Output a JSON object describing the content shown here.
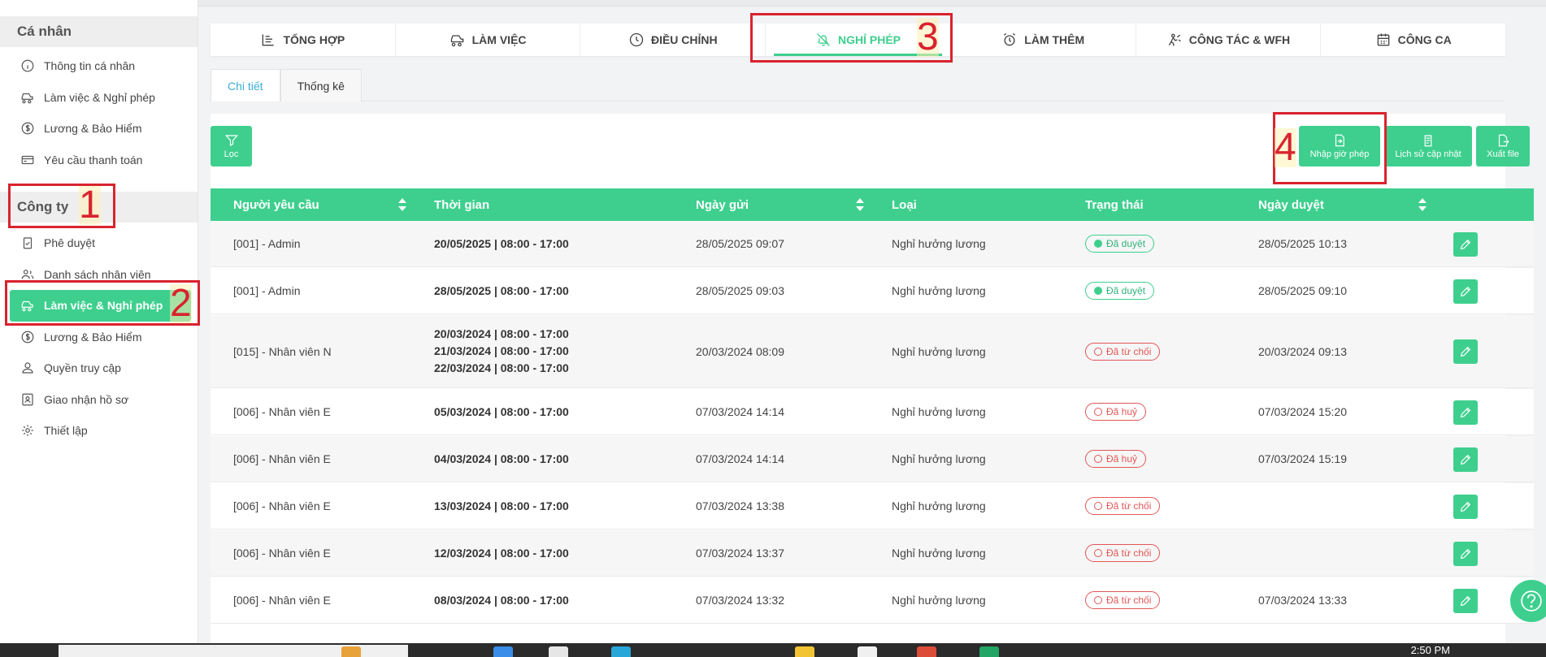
{
  "sidebar": {
    "personal_header": "Cá nhân",
    "personal_items": [
      {
        "label": "Thông tin cá nhân",
        "icon": "info-icon"
      },
      {
        "label": "Làm việc & Nghỉ phép",
        "icon": "car-icon"
      },
      {
        "label": "Lương & Bảo Hiểm",
        "icon": "dollar-icon"
      },
      {
        "label": "Yêu cầu thanh toán",
        "icon": "card-icon"
      }
    ],
    "company_header": "Công ty",
    "company_items": [
      {
        "label": "Phê duyệt",
        "icon": "clipboard-check-icon"
      },
      {
        "label": "Danh sách nhân viên",
        "icon": "users-icon"
      },
      {
        "label": "Làm việc & Nghỉ phép",
        "icon": "car-icon",
        "active": true
      },
      {
        "label": "Lương & Bảo Hiểm",
        "icon": "dollar-icon"
      },
      {
        "label": "Quyền truy cập",
        "icon": "user-icon"
      },
      {
        "label": "Giao nhận hồ sơ",
        "icon": "id-card-icon"
      },
      {
        "label": "Thiết lập",
        "icon": "gear-icon"
      }
    ]
  },
  "tabs": [
    {
      "label": "TỔNG HỢP",
      "icon": "list-chart-icon"
    },
    {
      "label": "LÀM VIỆC",
      "icon": "car-icon"
    },
    {
      "label": "ĐIỀU CHỈNH",
      "icon": "clock-icon"
    },
    {
      "label": "NGHỈ PHÉP",
      "icon": "bell-off-icon",
      "active": true
    },
    {
      "label": "LÀM THÊM",
      "icon": "alarm-icon"
    },
    {
      "label": "CÔNG TÁC & WFH",
      "icon": "travel-icon"
    },
    {
      "label": "CÔNG CA",
      "icon": "calendar-icon"
    }
  ],
  "subtabs": [
    {
      "label": "Chi tiết",
      "active": true
    },
    {
      "label": "Thống kê"
    }
  ],
  "toolbar": {
    "filter_label": "Lọc",
    "import_label": "Nhập giờ phép",
    "history_label": "Lịch sử cập nhật",
    "export_label": "Xuất file"
  },
  "table": {
    "headers": [
      "Người yêu cầu",
      "Thời gian",
      "Ngày gửi",
      "Loại",
      "Trạng thái",
      "Ngày duyệt"
    ],
    "rows": [
      {
        "requester": "[001] - Admin",
        "times": [
          "20/05/2025 | 08:00 - 17:00"
        ],
        "sent": "28/05/2025 09:07",
        "type": "Nghỉ hưởng lương",
        "status": "Đã duyệt",
        "status_kind": "ok",
        "approved": "28/05/2025 10:13"
      },
      {
        "requester": "[001] - Admin",
        "times": [
          "28/05/2025 | 08:00 - 17:00"
        ],
        "sent": "28/05/2025 09:03",
        "type": "Nghỉ hưởng lương",
        "status": "Đã duyệt",
        "status_kind": "ok",
        "approved": "28/05/2025 09:10"
      },
      {
        "requester": "[015] - Nhân viên N",
        "times": [
          "20/03/2024 | 08:00 - 17:00",
          "21/03/2024 | 08:00 - 17:00",
          "22/03/2024 | 08:00 - 17:00"
        ],
        "sent": "20/03/2024 08:09",
        "type": "Nghỉ hưởng lương",
        "status": "Đã từ chối",
        "status_kind": "no",
        "approved": "20/03/2024 09:13"
      },
      {
        "requester": "[006] - Nhân viên E",
        "times": [
          "05/03/2024 | 08:00 - 17:00"
        ],
        "sent": "07/03/2024 14:14",
        "type": "Nghỉ hưởng lương",
        "status": "Đã huỷ",
        "status_kind": "no",
        "approved": "07/03/2024 15:20"
      },
      {
        "requester": "[006] - Nhân viên E",
        "times": [
          "04/03/2024 | 08:00 - 17:00"
        ],
        "sent": "07/03/2024 14:14",
        "type": "Nghỉ hưởng lương",
        "status": "Đã huỷ",
        "status_kind": "no",
        "approved": "07/03/2024 15:19"
      },
      {
        "requester": "[006] - Nhân viên E",
        "times": [
          "13/03/2024 | 08:00 - 17:00"
        ],
        "sent": "07/03/2024 13:38",
        "type": "Nghỉ hưởng lương",
        "status": "Đã từ chối",
        "status_kind": "no",
        "approved": ""
      },
      {
        "requester": "[006] - Nhân viên E",
        "times": [
          "12/03/2024 | 08:00 - 17:00"
        ],
        "sent": "07/03/2024 13:37",
        "type": "Nghỉ hưởng lương",
        "status": "Đã từ chối",
        "status_kind": "no",
        "approved": ""
      },
      {
        "requester": "[006] - Nhân viên E",
        "times": [
          "08/03/2024 | 08:00 - 17:00"
        ],
        "sent": "07/03/2024 13:32",
        "type": "Nghỉ hưởng lương",
        "status": "Đã từ chối",
        "status_kind": "no",
        "approved": "07/03/2024 13:33"
      }
    ]
  },
  "annotations": [
    "1",
    "2",
    "3",
    "4"
  ],
  "taskbar": {
    "clock": "2:50 PM"
  },
  "colors": {
    "accent": "#3ecf8e",
    "annotation_red": "#d9232e",
    "reject": "#e25656",
    "subtab_active": "#3aaed8"
  }
}
